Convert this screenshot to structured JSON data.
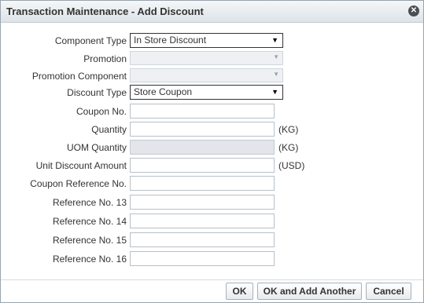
{
  "dialog": {
    "title": "Transaction Maintenance - Add Discount",
    "close_icon": "close-icon"
  },
  "form": {
    "component_type": {
      "label": "Component Type",
      "value": "In Store Discount"
    },
    "promotion": {
      "label": "Promotion",
      "value": ""
    },
    "promotion_component": {
      "label": "Promotion Component",
      "value": ""
    },
    "discount_type": {
      "label": "Discount Type",
      "value": "Store Coupon"
    },
    "coupon_no": {
      "label": "Coupon No.",
      "value": ""
    },
    "quantity": {
      "label": "Quantity",
      "value": "",
      "unit": "(KG)"
    },
    "uom_quantity": {
      "label": "UOM Quantity",
      "value": "",
      "unit": "(KG)"
    },
    "unit_discount_amount": {
      "label": "Unit Discount Amount",
      "value": "",
      "unit": "(USD)"
    },
    "coupon_reference_no": {
      "label": "Coupon Reference No.",
      "value": ""
    },
    "reference_no_13": {
      "label": "Reference No. 13",
      "value": ""
    },
    "reference_no_14": {
      "label": "Reference No. 14",
      "value": ""
    },
    "reference_no_15": {
      "label": "Reference No. 15",
      "value": ""
    },
    "reference_no_16": {
      "label": "Reference No. 16",
      "value": ""
    }
  },
  "buttons": {
    "ok": "OK",
    "ok_add_another": "OK and Add Another",
    "cancel": "Cancel"
  }
}
